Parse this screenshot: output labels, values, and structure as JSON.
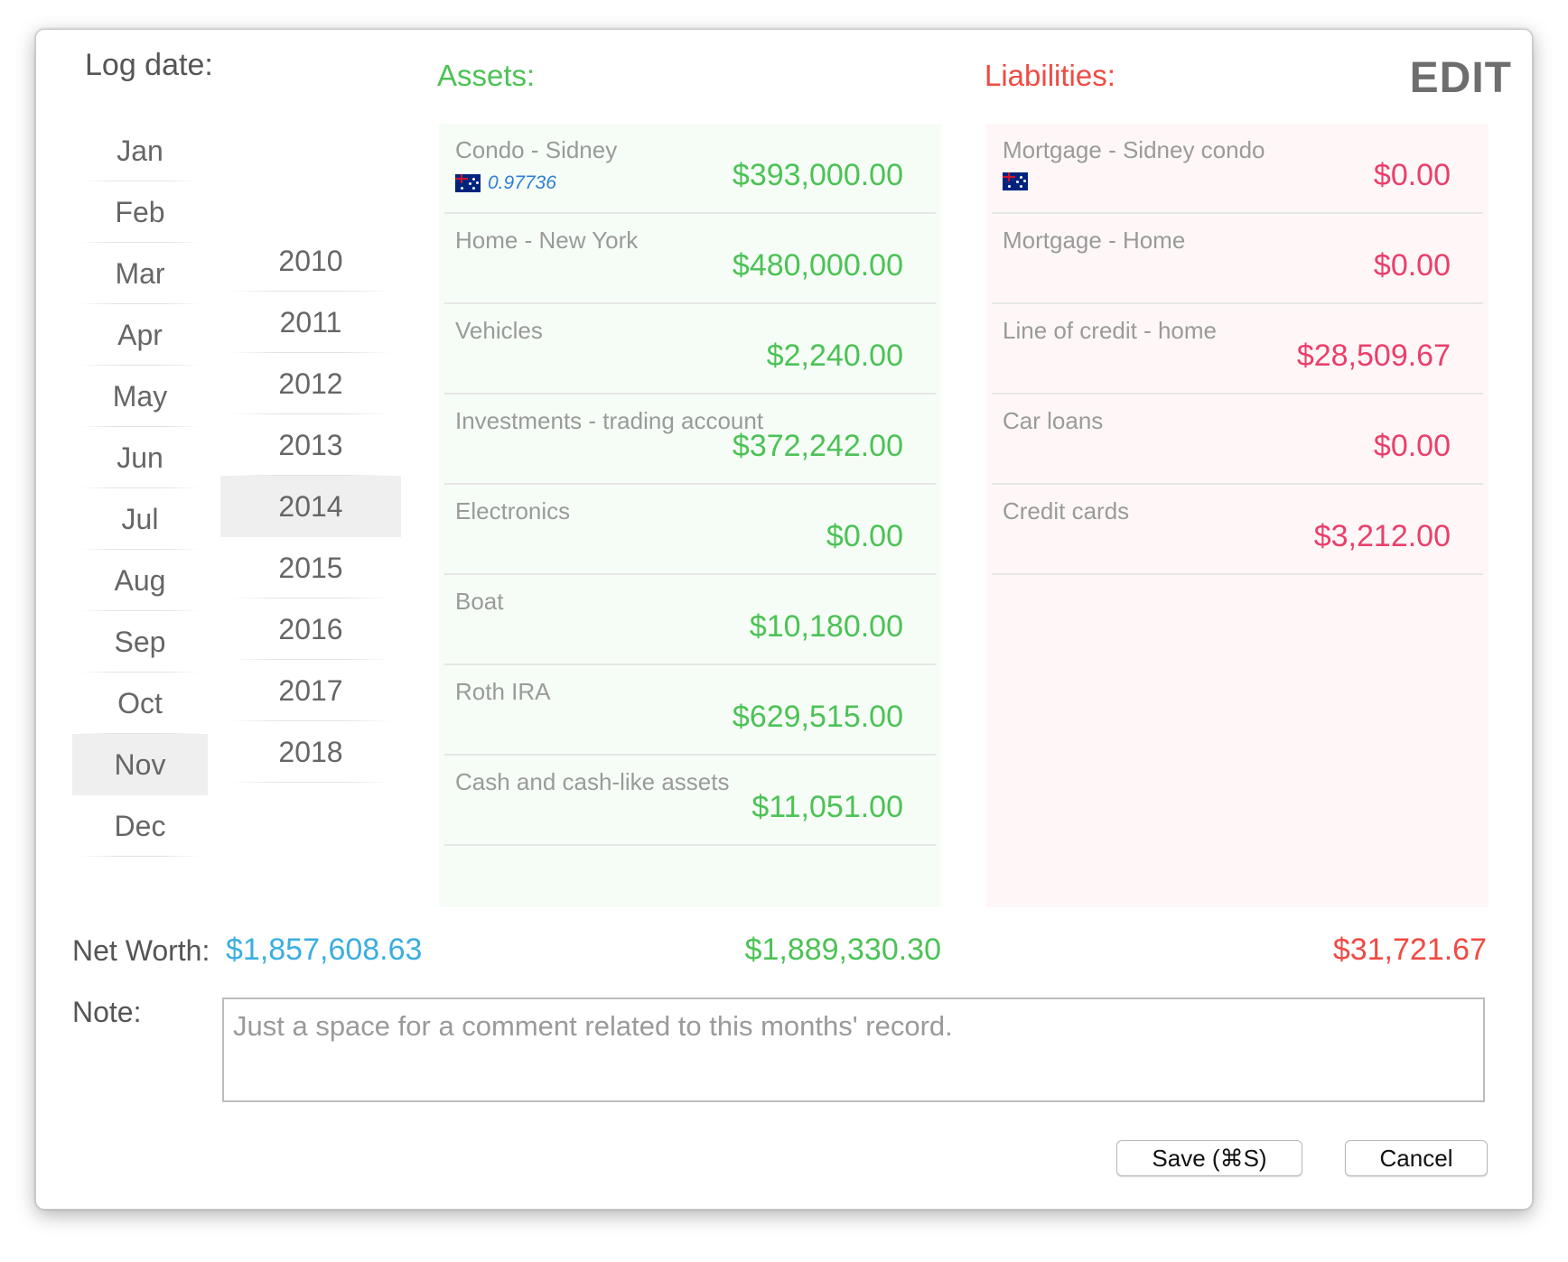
{
  "header": {
    "log_date_label": "Log date:",
    "assets_title": "Assets:",
    "liabilities_title": "Liabilities:",
    "mode_label": "EDIT"
  },
  "months": [
    "Jan",
    "Feb",
    "Mar",
    "Apr",
    "May",
    "Jun",
    "Jul",
    "Aug",
    "Sep",
    "Oct",
    "Nov",
    "Dec"
  ],
  "selected_month": "Nov",
  "years": [
    "2010",
    "2011",
    "2012",
    "2013",
    "2014",
    "2015",
    "2016",
    "2017",
    "2018"
  ],
  "selected_year": "2014",
  "assets": [
    {
      "name": "Condo - Sidney",
      "value": "$393,000.00",
      "flag": "australia-flag-icon",
      "rate": "0.97736"
    },
    {
      "name": "Home - New York",
      "value": "$480,000.00"
    },
    {
      "name": "Vehicles",
      "value": "$2,240.00"
    },
    {
      "name": "Investments - trading account",
      "value": "$372,242.00"
    },
    {
      "name": "Electronics",
      "value": "$0.00"
    },
    {
      "name": "Boat",
      "value": "$10,180.00"
    },
    {
      "name": "Roth IRA",
      "value": "$629,515.00"
    },
    {
      "name": "Cash and cash-like assets",
      "value": "$11,051.00"
    }
  ],
  "liabilities": [
    {
      "name": "Mortgage - Sidney condo",
      "value": "$0.00",
      "flag": "australia-flag-icon"
    },
    {
      "name": "Mortgage - Home",
      "value": "$0.00"
    },
    {
      "name": "Line of credit - home",
      "value": "$28,509.67"
    },
    {
      "name": "Car loans",
      "value": "$0.00"
    },
    {
      "name": "Credit cards",
      "value": "$3,212.00"
    }
  ],
  "totals": {
    "net_worth_label": "Net Worth:",
    "net_worth_value": "$1,857,608.63",
    "assets_total": "$1,889,330.30",
    "liabilities_total": "$31,721.67"
  },
  "note": {
    "label": "Note:",
    "placeholder": "Just a space for a comment related to this months' record."
  },
  "buttons": {
    "save_label": "Save  (⌘S)",
    "cancel_label": "Cancel"
  },
  "colors": {
    "assets": "#4cc256",
    "liabilities": "#f04a43",
    "liability_values": "#ea3f6c",
    "net_worth": "#3baedf"
  }
}
